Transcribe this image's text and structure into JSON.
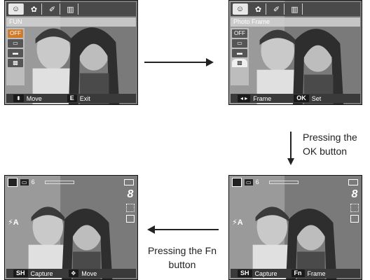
{
  "tabs": [
    "☺",
    "✿",
    "✐",
    "▥"
  ],
  "screen_1": {
    "menu_title": "FUN",
    "options": [
      "OFF",
      "▭",
      "▬",
      "▩"
    ],
    "bottom": {
      "key1": "⬍",
      "label1": "Move",
      "key2": "E",
      "label2": "Exit"
    }
  },
  "screen_2": {
    "menu_title": "Photo Frame",
    "options": [
      "OFF",
      "▭",
      "▬",
      "▩"
    ],
    "bottom": {
      "key1": "◂ ▸",
      "label1": "Frame",
      "key2": "OK",
      "label2": "Set"
    }
  },
  "screen_3": {
    "card_count": "6",
    "size": "8",
    "flash": "⚡A",
    "bottom": {
      "key1": "SH",
      "label1": "Capture",
      "key2": "✥",
      "label2": "Move"
    }
  },
  "screen_4": {
    "card_count": "6",
    "size": "8",
    "flash": "⚡A",
    "bottom": {
      "key1": "SH",
      "label1": "Capture",
      "key2": "Fn",
      "label2": "Frame"
    }
  },
  "captions": {
    "ok": [
      "Pressing the",
      "OK button"
    ],
    "fn": [
      "Pressing the Fn",
      "button"
    ]
  }
}
